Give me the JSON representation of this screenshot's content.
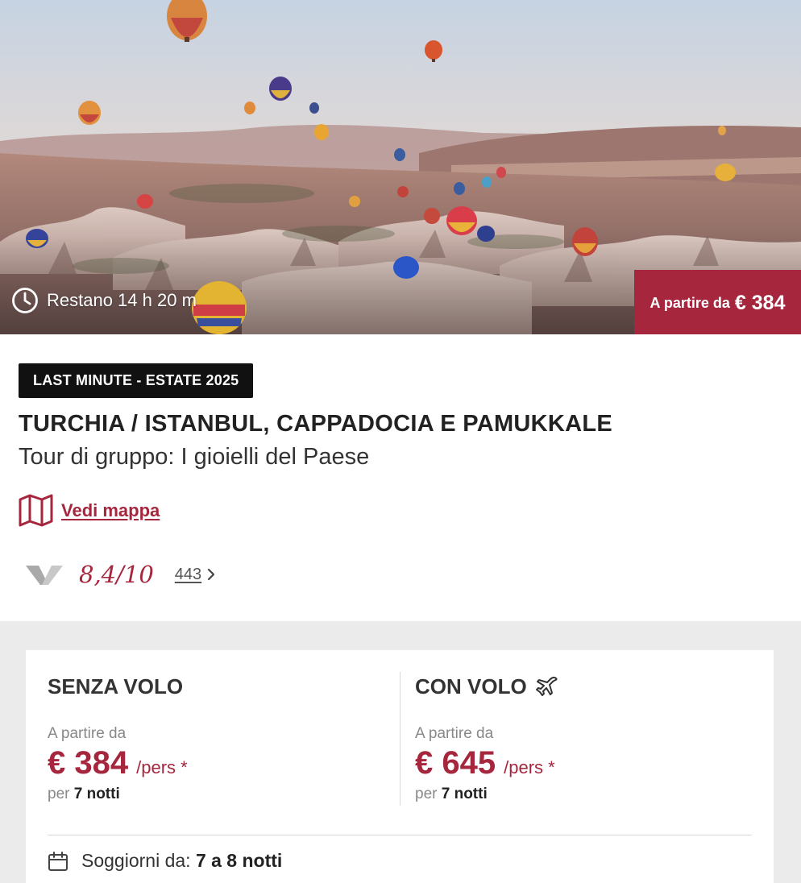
{
  "hero": {
    "countdown": "Restano 14 h 20 m",
    "price_prefix": "A partire da",
    "price_value": "€ 384"
  },
  "info": {
    "badge": "LAST MINUTE - ESTATE 2025",
    "title": "TURCHIA / ISTANBUL, CAPPADOCIA E PAMUKKALE",
    "subtitle": "Tour di gruppo: I gioielli del Paese",
    "map_link": "Vedi mappa",
    "rating_score": "8,4/10",
    "rating_count": "443"
  },
  "offers": {
    "without_flight": {
      "title": "SENZA VOLO",
      "from_label": "A partire da",
      "price": "€ 384",
      "unit": "/pers *",
      "nights_prefix": "per",
      "nights": "7 notti"
    },
    "with_flight": {
      "title": "CON VOLO",
      "from_label": "A partire da",
      "price": "€ 645",
      "unit": "/pers *",
      "nights_prefix": "per",
      "nights": "7 notti"
    },
    "stay_label": "Soggiorni da:",
    "stay_value": "7 a 8 notti"
  },
  "colors": {
    "accent": "#a6263e",
    "badge_bg": "#111111",
    "section_bg": "#ebebeb"
  },
  "icons": [
    "clock-icon",
    "map-icon",
    "v-logo-icon",
    "chevron-right-icon",
    "plane-icon",
    "calendar-icon"
  ]
}
